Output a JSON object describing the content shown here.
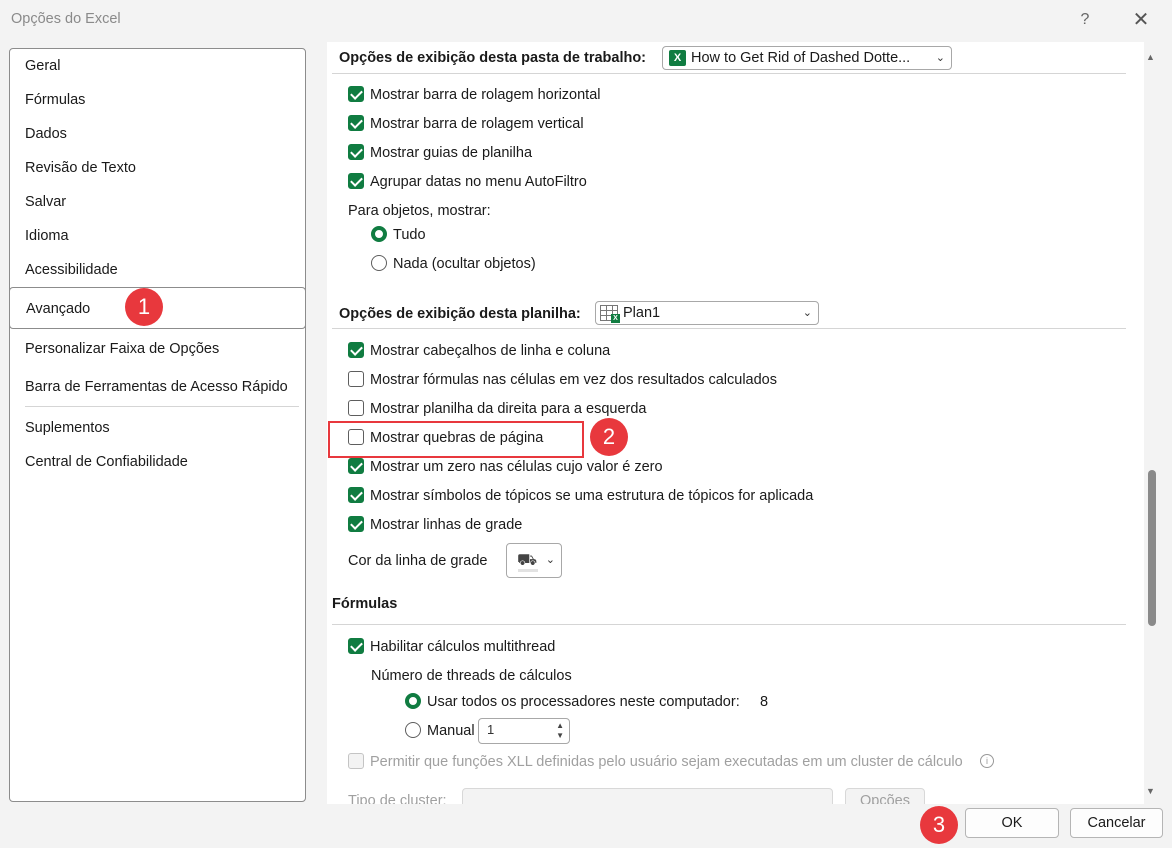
{
  "window": {
    "title": "Opções do Excel",
    "help": "?",
    "close": "✕"
  },
  "sidebar": {
    "items": [
      {
        "label": "Geral"
      },
      {
        "label": "Fórmulas"
      },
      {
        "label": "Dados"
      },
      {
        "label": "Revisão de Texto"
      },
      {
        "label": "Salvar"
      },
      {
        "label": "Idioma"
      },
      {
        "label": "Acessibilidade"
      },
      {
        "label": "Avançado",
        "active": true
      },
      {
        "label": "Personalizar Faixa de Opções"
      },
      {
        "label": "Barra de Ferramentas de Acesso Rápido"
      },
      {
        "label": "Suplementos"
      },
      {
        "label": "Central de Confiabilidade"
      }
    ]
  },
  "workbook_section": {
    "title": "Opções de exibição desta pasta de trabalho:",
    "combo_value": "How to Get Rid of Dashed  Dotte...",
    "checks": [
      {
        "label": "Mostrar barra de rolagem horizontal",
        "checked": true
      },
      {
        "label": "Mostrar barra de rolagem vertical",
        "checked": true
      },
      {
        "label": "Mostrar guias de planilha",
        "checked": true
      },
      {
        "label": "Agrupar datas no menu AutoFiltro",
        "checked": true
      }
    ],
    "objects_label": "Para objetos, mostrar:",
    "radios": [
      {
        "label": "Tudo",
        "checked": true
      },
      {
        "label": "Nada (ocultar objetos)",
        "checked": false
      }
    ]
  },
  "sheet_section": {
    "title": "Opções de exibição desta planilha:",
    "combo_value": "Plan1",
    "checks": [
      {
        "label": "Mostrar cabeçalhos de linha e coluna",
        "checked": true
      },
      {
        "label": "Mostrar fórmulas nas células em vez dos resultados calculados",
        "checked": false
      },
      {
        "label": "Mostrar planilha da direita para a esquerda",
        "checked": false
      },
      {
        "label": "Mostrar quebras de página",
        "checked": false
      },
      {
        "label": "Mostrar um zero nas células cujo valor é zero",
        "checked": true
      },
      {
        "label": "Mostrar símbolos de tópicos se uma estrutura de tópicos for aplicada",
        "checked": true
      },
      {
        "label": "Mostrar linhas de grade",
        "checked": true
      }
    ],
    "gridline_color_label": "Cor da linha de grade"
  },
  "formulas_section": {
    "title": "Fórmulas",
    "multithread_label": "Habilitar cálculos multithread",
    "multithread_checked": true,
    "threads_label": "Número de threads de cálculos",
    "use_all_label": "Usar todos os processadores neste computador:",
    "use_all_value": "8",
    "manual_label": "Manual",
    "manual_value": "1",
    "xll_label": "Permitir que funções XLL definidas pelo usuário sejam executadas em um cluster de cálculo",
    "cluster_type_label": "Tipo de cluster:",
    "options_button": "Opções"
  },
  "footer": {
    "ok": "OK",
    "cancel": "Cancelar"
  },
  "annotations": [
    "1",
    "2",
    "3"
  ],
  "colors": {
    "accent": "#107c41",
    "annotation": "#e8383d"
  }
}
